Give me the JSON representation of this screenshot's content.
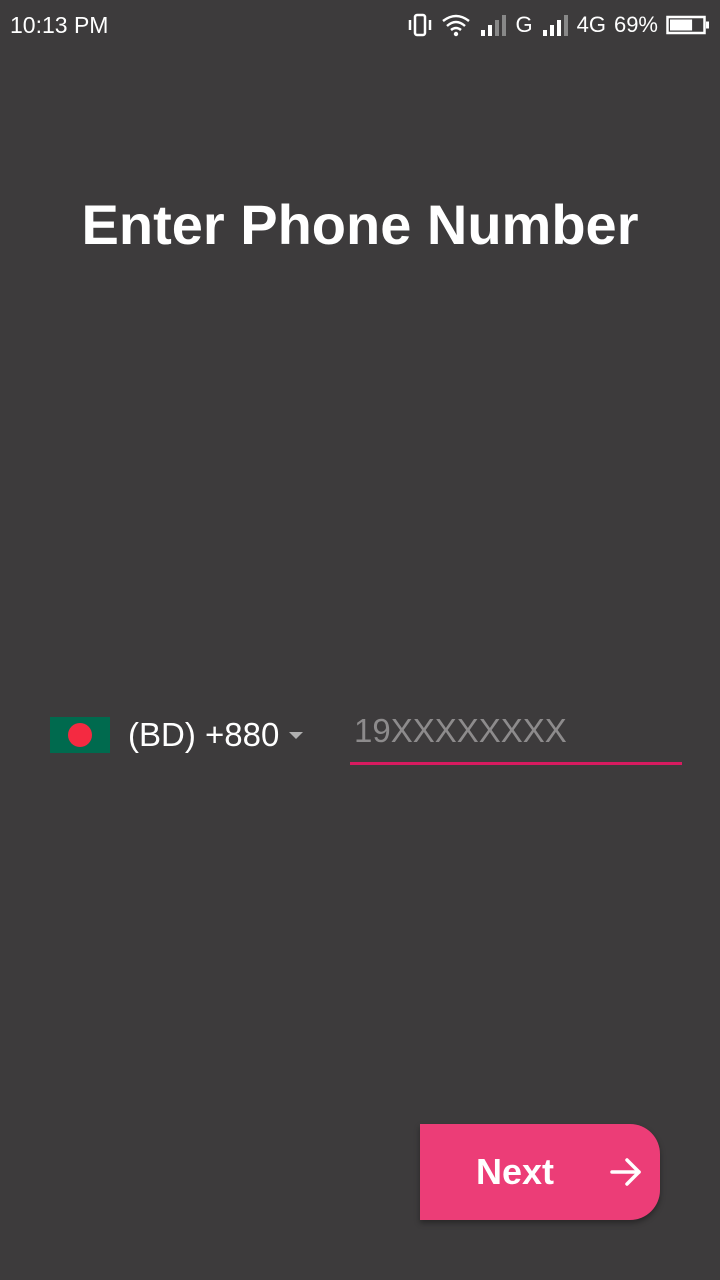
{
  "status_bar": {
    "time": "10:13 PM",
    "network_1": "G",
    "network_2": "4G",
    "battery": "69%",
    "battery_level": 0.69,
    "icons": [
      "vibrate-icon",
      "wifi-icon",
      "signal-icon",
      "signal-icon",
      "battery-icon"
    ]
  },
  "page": {
    "title": "Enter Phone Number"
  },
  "phone": {
    "country_code": "(BD) +880",
    "country_flag": "bangladesh-flag-icon",
    "input_value": "",
    "input_placeholder": "19XXXXXXXX"
  },
  "actions": {
    "next_label": "Next",
    "next_icon": "arrow-right-icon"
  },
  "colors": {
    "background": "#3d3b3c",
    "accent": "#ec3d77",
    "underline": "#d81b60"
  }
}
